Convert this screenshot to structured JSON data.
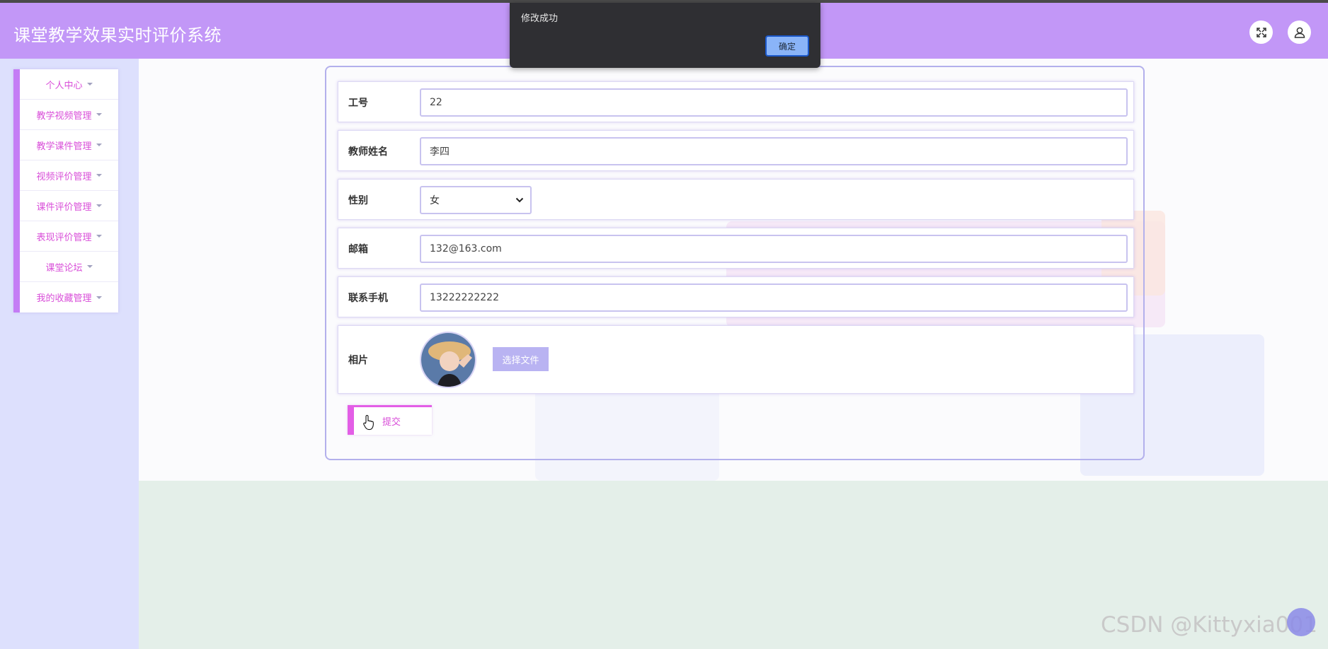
{
  "header": {
    "title": "课堂教学效果实时评价系统"
  },
  "sidebar": {
    "items": [
      {
        "label": "个人中心"
      },
      {
        "label": "教学视频管理"
      },
      {
        "label": "教学课件管理"
      },
      {
        "label": "视频评价管理"
      },
      {
        "label": "课件评价管理"
      },
      {
        "label": "表现评价管理"
      },
      {
        "label": "课堂论坛"
      },
      {
        "label": "我的收藏管理"
      }
    ]
  },
  "form": {
    "fields": [
      {
        "label": "工号",
        "value": "22"
      },
      {
        "label": "教师姓名",
        "value": "李四"
      },
      {
        "label": "性别",
        "value": "女"
      },
      {
        "label": "邮箱",
        "value": "132@163.com"
      },
      {
        "label": "联系手机",
        "value": "13222222222"
      },
      {
        "label": "相片"
      }
    ],
    "file_button": "选择文件",
    "submit_label": "提交"
  },
  "dialog": {
    "message": "修改成功",
    "ok_label": "确定"
  },
  "watermark": "CSDN @Kittyxia001",
  "colors": {
    "header": "#c297f7",
    "accent": "#d94fd9",
    "sidebar_bg": "#dde0fd",
    "panel_border": "#b3b0ec"
  },
  "icons": {
    "expand": "expand-icon",
    "user": "user-icon",
    "menu_caret": "caret-down-icon"
  }
}
